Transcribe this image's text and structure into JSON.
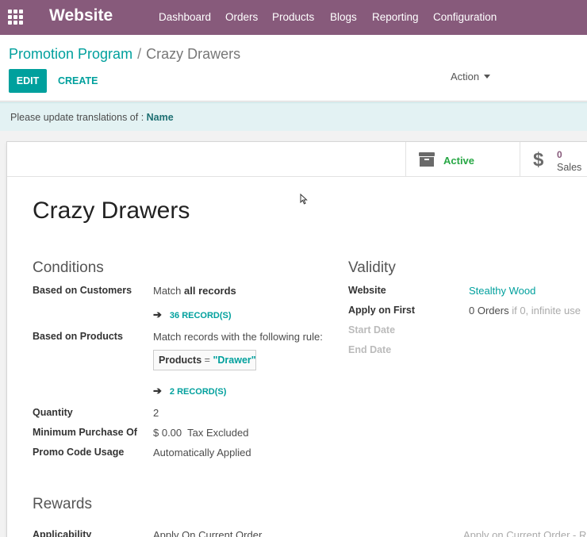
{
  "topbar": {
    "brand": "Website",
    "menu": [
      "Dashboard",
      "Orders",
      "Products",
      "Blogs",
      "Reporting",
      "Configuration"
    ]
  },
  "breadcrumb": {
    "parent": "Promotion Program",
    "separator": "/",
    "current": "Crazy Drawers"
  },
  "toolbar": {
    "edit": "EDIT",
    "create": "CREATE",
    "action": "Action"
  },
  "alert": {
    "text": "Please update translations of :",
    "field": "Name"
  },
  "smart_buttons": {
    "active": "Active",
    "sales_count": "0",
    "sales_label": "Sales"
  },
  "record": {
    "title": "Crazy Drawers",
    "conditions": {
      "heading": "Conditions",
      "customers_label": "Based on Customers",
      "customers_prefix": "Match",
      "customers_bold": "all records",
      "customers_records": "36 RECORD(S)",
      "products_label": "Based on Products",
      "products_rule": "Match records with the following rule:",
      "domain_field": "Products",
      "domain_op": "=",
      "domain_value": "\"Drawer\"",
      "products_records": "2 RECORD(S)",
      "quantity_label": "Quantity",
      "quantity_value": "2",
      "min_purchase_label": "Minimum Purchase Of",
      "min_purchase_value": "$ 0.00",
      "min_purchase_tax": "Tax Excluded",
      "promo_label": "Promo Code Usage",
      "promo_value": "Automatically Applied"
    },
    "validity": {
      "heading": "Validity",
      "website_label": "Website",
      "website_value": "Stealthy Wood",
      "apply_label": "Apply on First",
      "apply_value": "0 Orders",
      "apply_hint": "if 0, infinite use",
      "start_label": "Start Date",
      "end_label": "End Date"
    },
    "rewards": {
      "heading": "Rewards",
      "applicability_label": "Applicability",
      "applicability_value": "Apply On Current Order",
      "applicability_right": "Apply on Current Order - R"
    }
  },
  "colors": {
    "brand": "#875a7b",
    "accent": "#00a09d",
    "active": "#28a745"
  }
}
